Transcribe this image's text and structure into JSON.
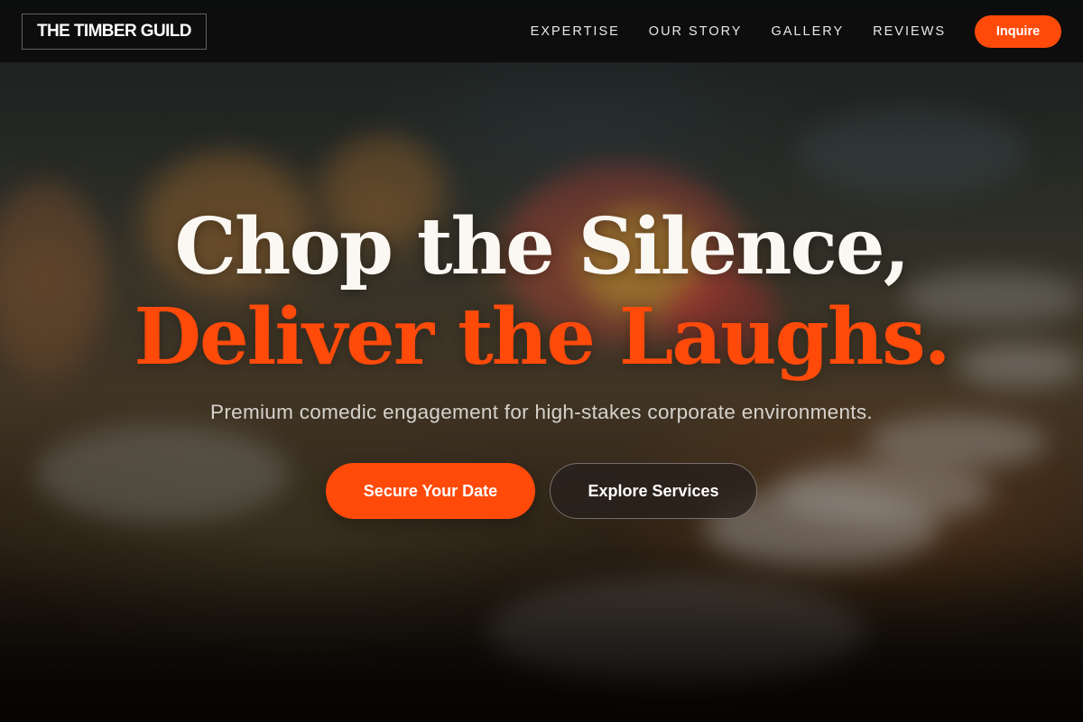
{
  "brand": {
    "name": "THE TIMBER GUILD"
  },
  "nav": {
    "links": [
      "EXPERTISE",
      "OUR STORY",
      "GALLERY",
      "REVIEWS"
    ],
    "cta_label": "Inquire"
  },
  "hero": {
    "headline_line1": "Chop the Silence,",
    "headline_line2": "Deliver the Laughs.",
    "subtitle": "Premium comedic engagement for high-stakes corporate environments.",
    "primary_cta": "Secure Your Date",
    "secondary_cta": "Explore Services",
    "background_image": "blurred banquet table with flower centerpiece, wine glasses and plates"
  },
  "colors": {
    "accent": "#ff4a0a",
    "nav_background": "#0c0c0c",
    "headline_light": "#fbf8f3"
  }
}
